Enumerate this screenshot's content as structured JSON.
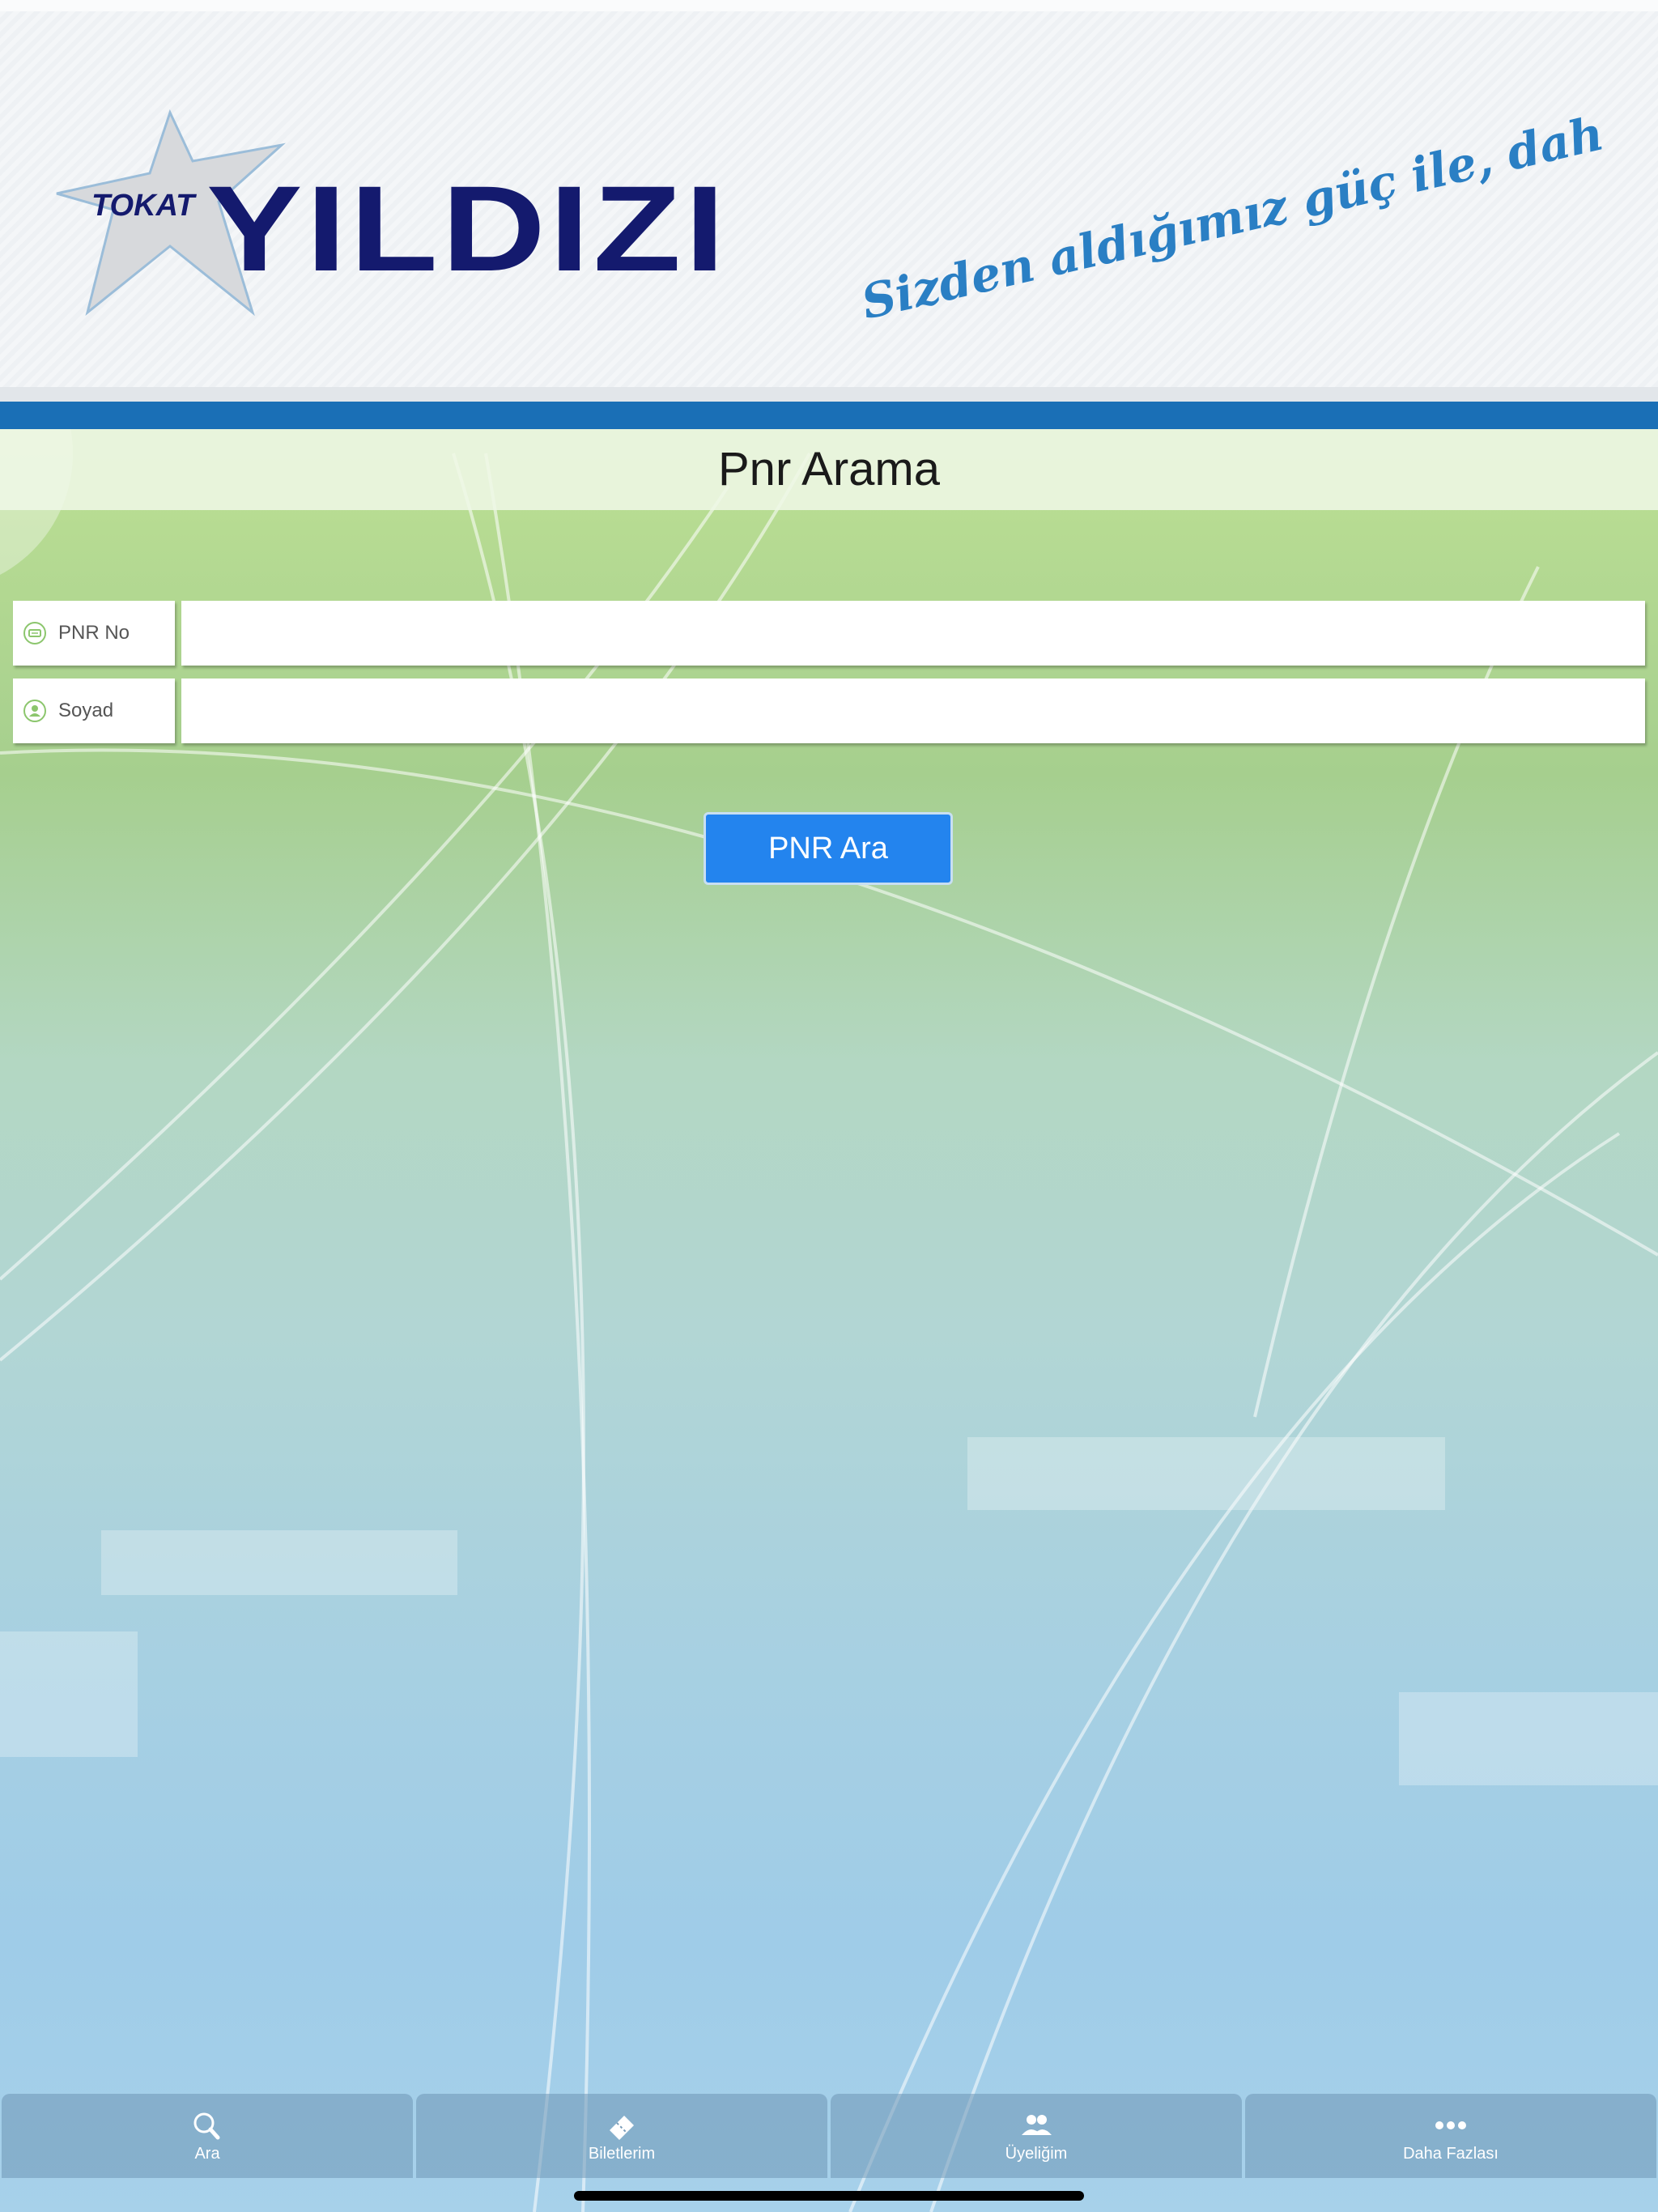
{
  "header": {
    "logo_prefix": "TOKAT",
    "logo_name": "YILDIZI",
    "slogan": "Sizden aldığımız güç ile, daha ileriye..."
  },
  "page": {
    "title": "Pnr Arama"
  },
  "form": {
    "pnr_label": "PNR No",
    "pnr_value": "",
    "surname_label": "Soyad",
    "surname_value": "",
    "submit_label": "PNR Ara"
  },
  "tabs": [
    {
      "label": "Ara",
      "icon": "search-icon"
    },
    {
      "label": "Biletlerim",
      "icon": "ticket-icon"
    },
    {
      "label": "Üyeliğim",
      "icon": "users-icon"
    },
    {
      "label": "Daha Fazlası",
      "icon": "more-icon"
    }
  ],
  "colors": {
    "brand_blue": "#1a6fb6",
    "button_blue": "#2384ee",
    "logo_navy": "#141a6e"
  }
}
